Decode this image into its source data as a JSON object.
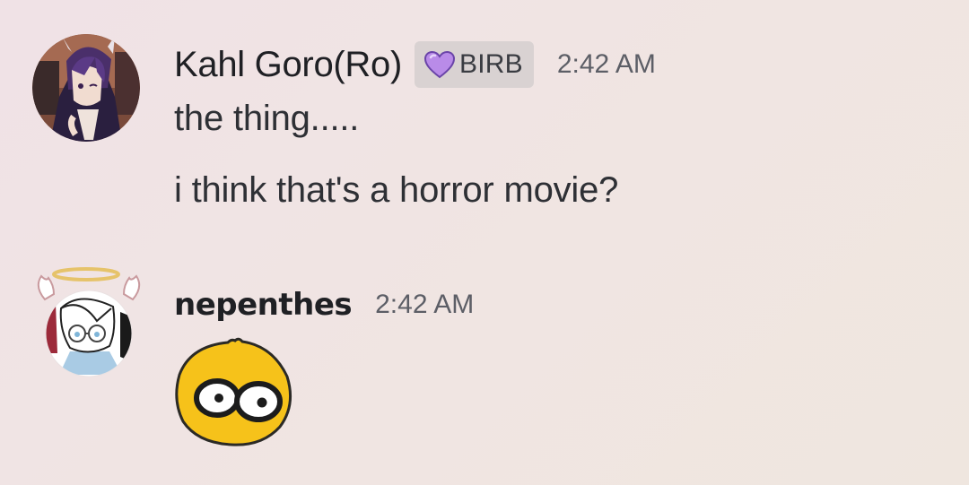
{
  "messages": [
    {
      "username": "Kahl Goro(Ro)",
      "role_tag": {
        "icon": "purple-heart-icon",
        "label": "BIRB",
        "color": "#b98be8"
      },
      "timestamp": "2:42 AM",
      "lines": [
        "the thing.....",
        "i think that's a horror movie?"
      ]
    },
    {
      "username": "nepenthes",
      "timestamp": "2:42 AM",
      "emoji": "wide-eyed-yellow-face-emoji"
    }
  ],
  "colors": {
    "username": "#1f2024",
    "text": "#2e3035",
    "timestamp": "#5c5e66",
    "tag_bg": "#d9d2d2",
    "emoji_yellow": "#f6c21a"
  }
}
